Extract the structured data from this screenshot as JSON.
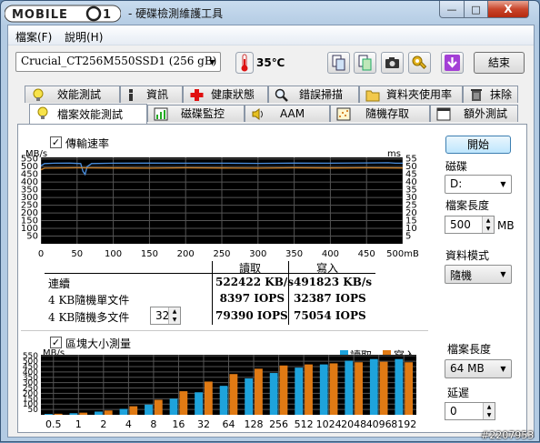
{
  "window": {
    "title": "- 硬碟檢測維護工具",
    "logo_text": "MOBILE01",
    "controls": {
      "minimize": "—",
      "maximize": "□",
      "close": "X"
    }
  },
  "menu": {
    "items": [
      "檔案(F)",
      "說明(H)"
    ]
  },
  "toolbar": {
    "drive": "Crucial_CT256M550SSD1 (256 gB)",
    "temperature": "35℃",
    "exit_label": "結束",
    "icons": [
      "copy-icon",
      "copy-green-icon",
      "camera-icon",
      "tools-icon",
      "download-icon"
    ]
  },
  "tabs_row1": [
    {
      "label": "效能測試",
      "icon": "lightbulb-icon"
    },
    {
      "label": "資訊",
      "icon": "info-icon"
    },
    {
      "label": "健康狀態",
      "icon": "red-cross-icon"
    },
    {
      "label": "錯誤掃描",
      "icon": "magnifier-icon"
    },
    {
      "label": "資料夾使用率",
      "icon": "folder-icon"
    },
    {
      "label": "抹除",
      "icon": "trash-icon"
    }
  ],
  "tabs_row2": [
    {
      "label": "檔案效能測試",
      "icon": "lightbulb-icon",
      "active": true
    },
    {
      "label": "磁碟監控",
      "icon": "chart-icon"
    },
    {
      "label": "AAM",
      "icon": "speaker-icon"
    },
    {
      "label": "隨機存取",
      "icon": "scatter-icon"
    },
    {
      "label": "額外測試",
      "icon": "window-icon"
    }
  ],
  "transfer": {
    "checkbox_label": "傳輸速率",
    "checked": true,
    "unit_left": "MB/s",
    "unit_right": "ms",
    "columns": [
      "讀取",
      "寫入"
    ],
    "rows": [
      {
        "label": "連續",
        "read": "522422 KB/s",
        "write": "491823 KB/s"
      },
      {
        "label": "4 KB隨機單文件",
        "read": "8397 IOPS",
        "write": "32387 IOPS"
      },
      {
        "label": "4 KB隨機多文件",
        "read": "79390 IOPS",
        "write": "75054 IOPS",
        "queue": "32"
      }
    ]
  },
  "block": {
    "checkbox_label": "區塊大小測量",
    "checked": true,
    "unit": "MB/s",
    "legend": [
      "讀取",
      "寫入"
    ]
  },
  "right_panel": {
    "start_label": "開始",
    "disk_label": "磁碟",
    "disk_value": "D:",
    "file_length_label": "檔案長度",
    "file_length_value": "500",
    "file_length_unit": "MB",
    "data_mode_label": "資料模式",
    "data_mode_value": "隨機",
    "file_length2_label": "檔案長度",
    "file_length2_value": "64 MB",
    "delay_label": "延遲",
    "delay_value": "0"
  },
  "watermark": "#2207953",
  "colors": {
    "read": "#1ea3dc",
    "write": "#e07a14",
    "grid": "#555555",
    "read_line": "#4a8fe0",
    "write_line": "#d0842c"
  },
  "chart_data": [
    {
      "type": "line",
      "title": "傳輸速率",
      "xlabel": "",
      "ylabel": "MB/s",
      "y2label": "ms",
      "x_ticks": [
        "0",
        "50",
        "100",
        "150",
        "200",
        "250",
        "300",
        "350",
        "400",
        "450",
        "500mB"
      ],
      "y_ticks": [
        550,
        500,
        450,
        400,
        350,
        300,
        250,
        200,
        150,
        100,
        50
      ],
      "y2_ticks": [
        55,
        50,
        45,
        40,
        35,
        30,
        25,
        20,
        15,
        10,
        5
      ],
      "xlim": [
        0,
        500
      ],
      "ylim": [
        0,
        560
      ],
      "grid": true,
      "series": [
        {
          "name": "讀取",
          "x": [
            0,
            5,
            20,
            40,
            55,
            58,
            61,
            64,
            70,
            100,
            150,
            200,
            250,
            300,
            350,
            400,
            450,
            480,
            490,
            500
          ],
          "y": [
            505,
            520,
            522,
            523,
            520,
            470,
            450,
            500,
            520,
            522,
            523,
            522,
            522,
            521,
            523,
            522,
            524,
            525,
            522,
            522
          ]
        },
        {
          "name": "寫入",
          "x": [
            0,
            5,
            50,
            100,
            150,
            200,
            250,
            300,
            350,
            400,
            450,
            500
          ],
          "y": [
            480,
            490,
            492,
            491,
            490,
            492,
            491,
            490,
            492,
            491,
            492,
            491
          ]
        }
      ]
    },
    {
      "type": "bar",
      "title": "區塊大小測量",
      "ylabel": "MB/s",
      "categories": [
        "0.5",
        "1",
        "2",
        "4",
        "8",
        "16",
        "32",
        "64",
        "128",
        "256",
        "512",
        "1024",
        "2048",
        "4096",
        "8192"
      ],
      "y_ticks": [
        550,
        500,
        450,
        400,
        350,
        300,
        250,
        200,
        150,
        100,
        50
      ],
      "ylim": [
        0,
        560
      ],
      "grid": true,
      "series": [
        {
          "name": "讀取",
          "values": [
            8,
            15,
            30,
            55,
            95,
            150,
            210,
            270,
            340,
            390,
            440,
            470,
            505,
            520,
            520
          ]
        },
        {
          "name": "寫入",
          "values": [
            10,
            20,
            40,
            80,
            140,
            220,
            310,
            380,
            430,
            460,
            470,
            480,
            490,
            495,
            490
          ]
        }
      ]
    }
  ]
}
